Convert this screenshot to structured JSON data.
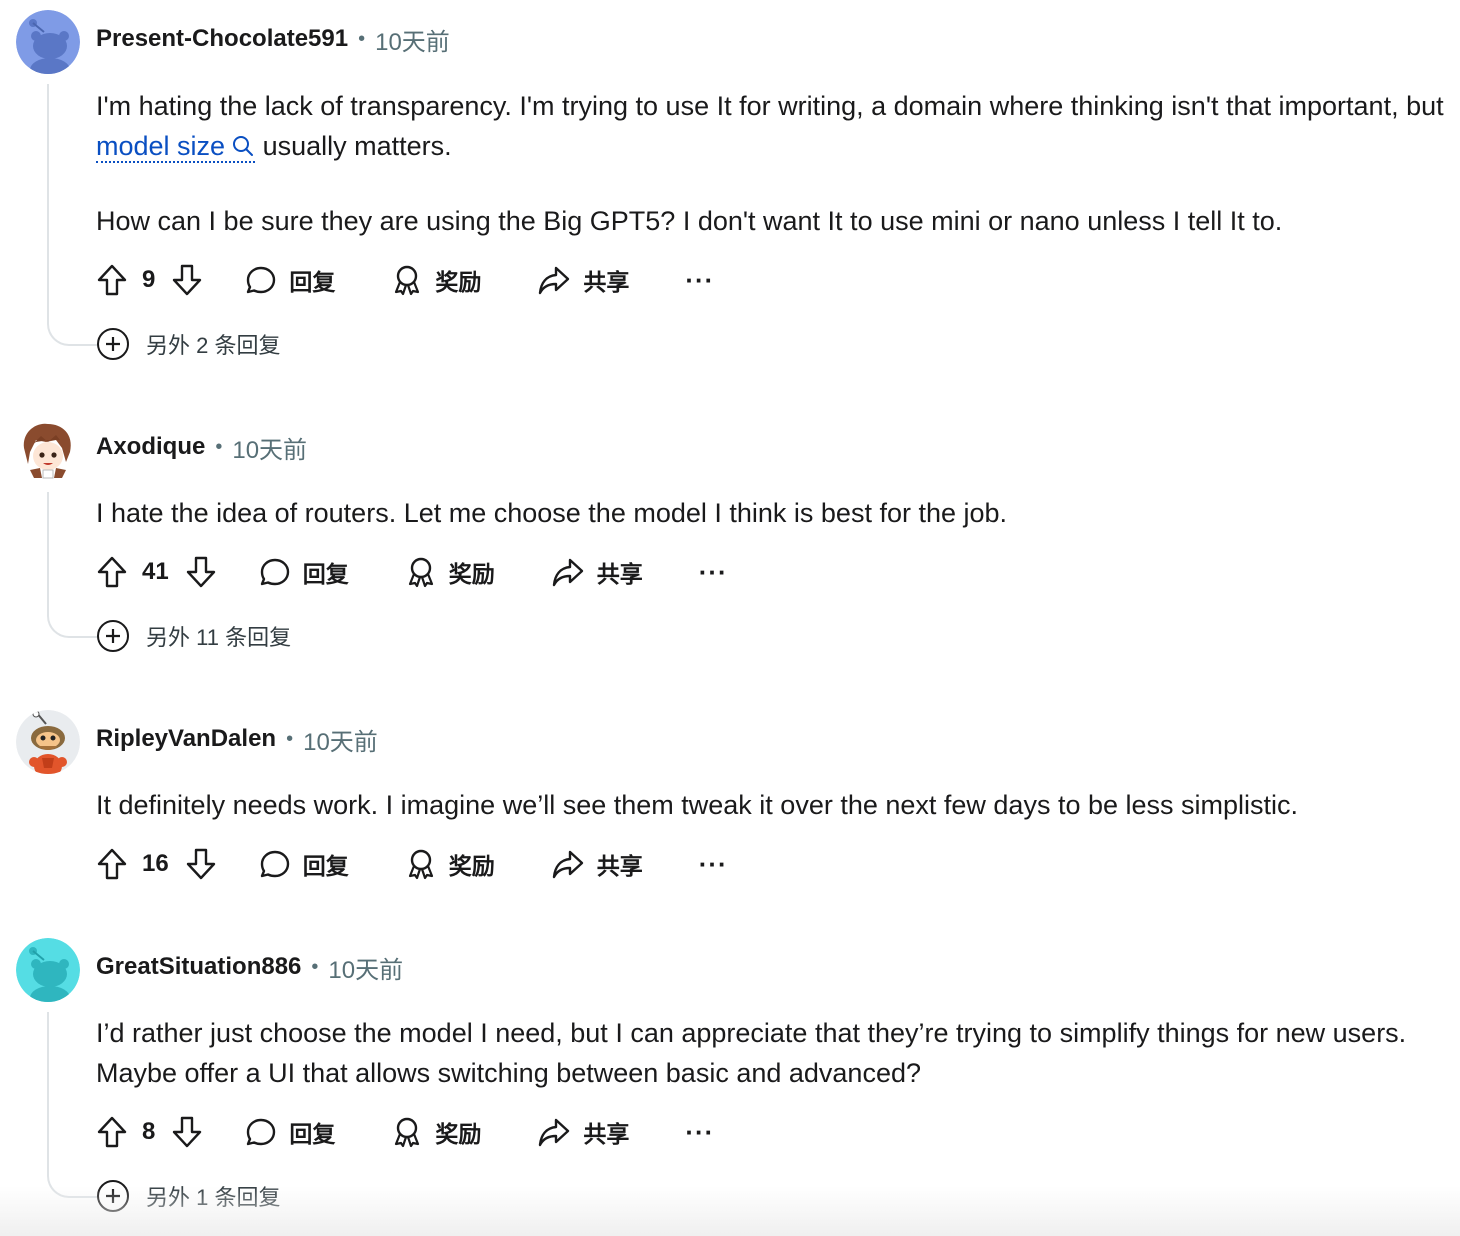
{
  "comments": [
    {
      "username": "Present-Chocolate591",
      "time": "10天前",
      "body_p1_a": "I'm hating the lack of transparency. I'm trying to use It for writing, a domain where thinking isn't that important, but ",
      "body_p1_link": "model size",
      "body_p1_b": " usually matters.",
      "body_p2": "How can I be sure they are using the Big GPT5? I don't want It to use mini or nano unless I tell It to.",
      "votes": "9",
      "reply_label": "回复",
      "award_label": "奖励",
      "share_label": "共享",
      "more_label": "···",
      "more_replies": "另外 2 条回复",
      "avatar_color": "#6b8ee0"
    },
    {
      "username": "Axodique",
      "time": "10天前",
      "body": "I hate the idea of routers. Let me choose the model I think is best for the job.",
      "votes": "41",
      "reply_label": "回复",
      "award_label": "奖励",
      "share_label": "共享",
      "more_label": "···",
      "more_replies": "另外 11 条回复"
    },
    {
      "username": "RipleyVanDalen",
      "time": "10天前",
      "body": "It definitely needs work. I imagine we’ll see them tweak it over the next few days to be less simplistic.",
      "votes": "16",
      "reply_label": "回复",
      "award_label": "奖励",
      "share_label": "共享",
      "more_label": "···"
    },
    {
      "username": "GreatSituation886",
      "time": "10天前",
      "body": "I’d rather just choose the model I need, but I can appreciate that they’re trying to simplify things for new users. Maybe offer a UI that allows switching between basic and advanced?",
      "votes": "8",
      "reply_label": "回复",
      "award_label": "奖励",
      "share_label": "共享",
      "more_label": "···",
      "more_replies": "另外 1 条回复",
      "avatar_color": "#46d8e0"
    }
  ],
  "colors": {
    "link": "#0a4fc2",
    "meta": "#576f76",
    "thread_line": "#dfe3e6"
  }
}
